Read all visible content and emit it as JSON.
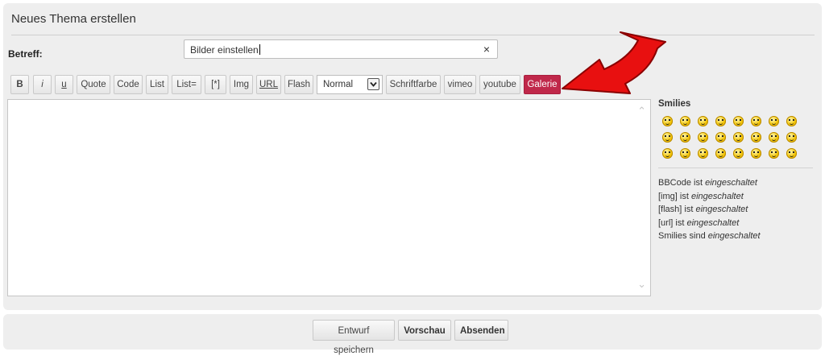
{
  "panel": {
    "title": "Neues Thema erstellen"
  },
  "subject": {
    "label": "Betreff:",
    "value": "Bilder einstellen",
    "clear": "×"
  },
  "toolbar": {
    "bold": "B",
    "italic": "i",
    "underline": "u",
    "quote": "Quote",
    "code": "Code",
    "list": "List",
    "list_eq": "List=",
    "list_item": "[*]",
    "img": "Img",
    "url": "URL",
    "flash": "Flash",
    "size_value": "Normal",
    "font_color": "Schriftfarbe",
    "vimeo": "vimeo",
    "youtube": "youtube",
    "gallery": "Galerie"
  },
  "colors": {
    "gallery_button": "#c0284a",
    "arrow": "#e81010",
    "panel_bg": "#eeeeee"
  },
  "sidebar": {
    "smilies_title": "Smilies",
    "smilies_count": 24,
    "status": [
      {
        "label": "BBCode ist",
        "value": "eingeschaltet"
      },
      {
        "label": "[img] ist",
        "value": "eingeschaltet"
      },
      {
        "label": "[flash] ist",
        "value": "eingeschaltet"
      },
      {
        "label": "[url] ist",
        "value": "eingeschaltet"
      },
      {
        "label": "Smilies sind",
        "value": "eingeschaltet"
      }
    ]
  },
  "actions": {
    "save_draft": "Entwurf speichern",
    "preview": "Vorschau",
    "submit": "Absenden"
  }
}
